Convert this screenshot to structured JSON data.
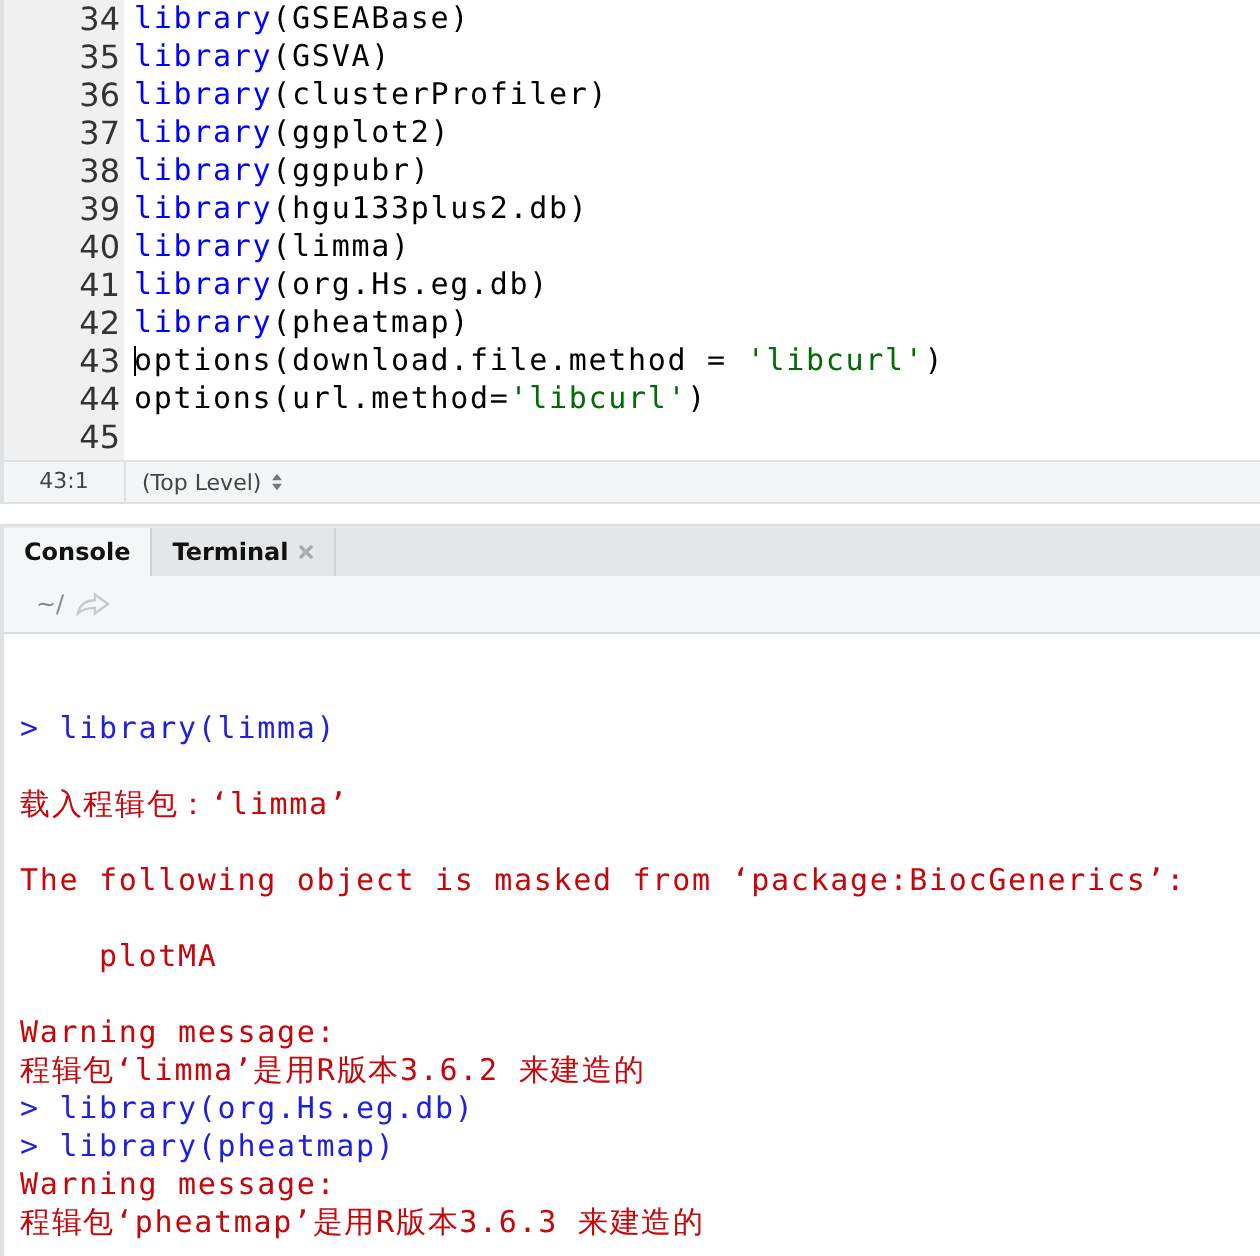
{
  "editor": {
    "lines": [
      {
        "number": "34",
        "cursor": false,
        "tokens": [
          {
            "kind": "function",
            "text": "library"
          },
          {
            "kind": "plain",
            "text": "(GSEABase)"
          }
        ]
      },
      {
        "number": "35",
        "cursor": false,
        "tokens": [
          {
            "kind": "function",
            "text": "library"
          },
          {
            "kind": "plain",
            "text": "(GSVA)"
          }
        ]
      },
      {
        "number": "36",
        "cursor": false,
        "tokens": [
          {
            "kind": "function",
            "text": "library"
          },
          {
            "kind": "plain",
            "text": "(clusterProfiler)"
          }
        ]
      },
      {
        "number": "37",
        "cursor": false,
        "tokens": [
          {
            "kind": "function",
            "text": "library"
          },
          {
            "kind": "plain",
            "text": "(ggplot2)"
          }
        ]
      },
      {
        "number": "38",
        "cursor": false,
        "tokens": [
          {
            "kind": "function",
            "text": "library"
          },
          {
            "kind": "plain",
            "text": "(ggpubr)"
          }
        ]
      },
      {
        "number": "39",
        "cursor": false,
        "tokens": [
          {
            "kind": "function",
            "text": "library"
          },
          {
            "kind": "plain",
            "text": "(hgu133plus2.db)"
          }
        ]
      },
      {
        "number": "40",
        "cursor": false,
        "tokens": [
          {
            "kind": "function",
            "text": "library"
          },
          {
            "kind": "plain",
            "text": "(limma)"
          }
        ]
      },
      {
        "number": "41",
        "cursor": false,
        "tokens": [
          {
            "kind": "function",
            "text": "library"
          },
          {
            "kind": "plain",
            "text": "(org.Hs.eg.db)"
          }
        ]
      },
      {
        "number": "42",
        "cursor": false,
        "tokens": [
          {
            "kind": "function",
            "text": "library"
          },
          {
            "kind": "plain",
            "text": "(pheatmap)"
          }
        ]
      },
      {
        "number": "43",
        "cursor": true,
        "tokens": [
          {
            "kind": "plain",
            "text": "options(download.file.method = "
          },
          {
            "kind": "string",
            "text": "'libcurl'"
          },
          {
            "kind": "plain",
            "text": ")"
          }
        ]
      },
      {
        "number": "44",
        "cursor": false,
        "tokens": [
          {
            "kind": "plain",
            "text": "options(url.method="
          },
          {
            "kind": "string",
            "text": "'libcurl'"
          },
          {
            "kind": "plain",
            "text": ")"
          }
        ]
      },
      {
        "number": "45",
        "cursor": false
      }
    ]
  },
  "status_bar": {
    "position": "43:1",
    "scope": "(Top Level)"
  },
  "tabs": [
    {
      "label": "Console",
      "selected": true,
      "closable": false
    },
    {
      "label": "Terminal",
      "selected": false,
      "closable": true
    }
  ],
  "console_toolbar": {
    "path": "~/"
  },
  "console": {
    "lines": [
      {
        "kind": "blank"
      },
      {
        "kind": "blank"
      },
      {
        "kind": "command",
        "text": "> library(limma)"
      },
      {
        "kind": "blank"
      },
      {
        "kind": "message",
        "text": "载入程辑包：‘limma’"
      },
      {
        "kind": "blank"
      },
      {
        "kind": "message",
        "text": "The following object is masked from ‘package:BiocGenerics’:"
      },
      {
        "kind": "blank"
      },
      {
        "kind": "message",
        "text": "    plotMA"
      },
      {
        "kind": "blank"
      },
      {
        "kind": "message",
        "text": "Warning message:"
      },
      {
        "kind": "message",
        "text": "程辑包‘limma’是用R版本3.6.2 来建造的"
      },
      {
        "kind": "command",
        "text": "> library(org.Hs.eg.db)"
      },
      {
        "kind": "command",
        "text": "> library(pheatmap)"
      },
      {
        "kind": "message",
        "text": "Warning message:"
      },
      {
        "kind": "message",
        "text": "程辑包‘pheatmap’是用R版本3.6.3 来建造的"
      }
    ]
  }
}
